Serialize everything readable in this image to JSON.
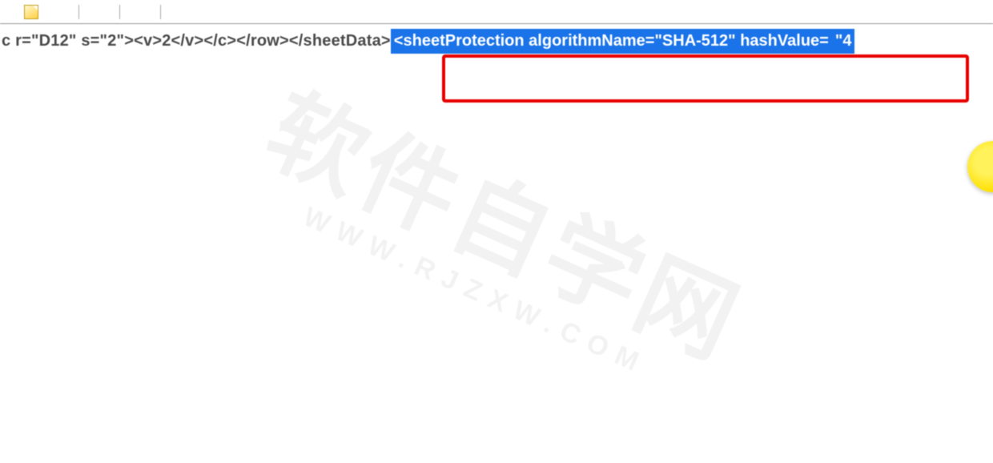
{
  "toolbar": {
    "items": [
      {
        "name": "notepad-icon"
      },
      {
        "name": "toolbar-sep-1"
      },
      {
        "name": "toolbar-sep-2"
      },
      {
        "name": "toolbar-sep-3"
      }
    ]
  },
  "editor": {
    "plain_segment": "c r=\"D12\" s=\"2\"><v>2</v></c></row></sheetData>",
    "selected_segment": "<sheetProtection algorithmName=\"SHA-512\" hashValue=",
    "tail_segment": "\"4"
  },
  "highlight": {
    "label": "sheetProtection-highlight"
  },
  "watermark": {
    "main": "软件自学网",
    "sub": "WWW.RJZXW.COM"
  },
  "cursor": {
    "label": "pointer-highlight"
  }
}
